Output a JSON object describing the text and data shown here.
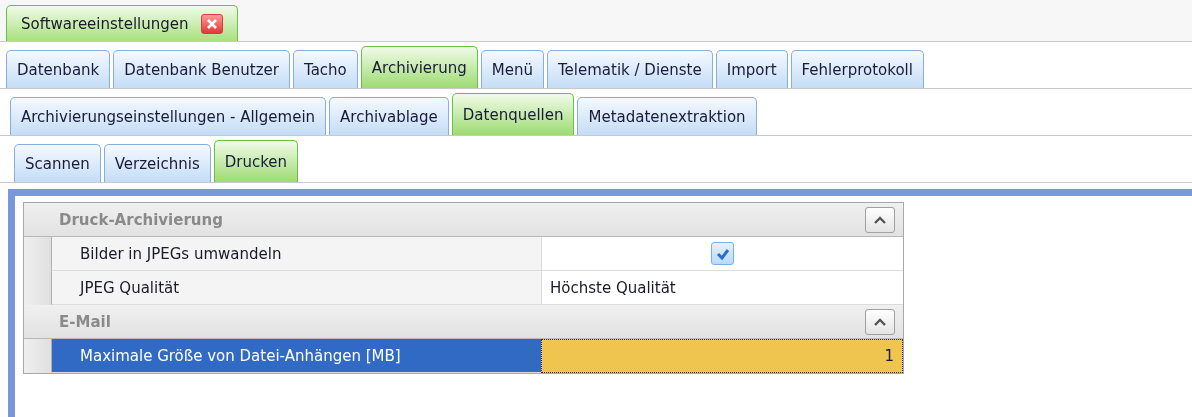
{
  "document_tab": {
    "title": "Softwareeinstellungen"
  },
  "tabs": [
    {
      "label": "Datenbank",
      "selected": false
    },
    {
      "label": "Datenbank Benutzer",
      "selected": false
    },
    {
      "label": "Tacho",
      "selected": false
    },
    {
      "label": "Archivierung",
      "selected": true
    },
    {
      "label": "Menü",
      "selected": false
    },
    {
      "label": "Telematik / Dienste",
      "selected": false
    },
    {
      "label": "Import",
      "selected": false
    },
    {
      "label": "Fehlerprotokoll",
      "selected": false
    }
  ],
  "subtabs": [
    {
      "label": "Archivierungseinstellungen - Allgemein",
      "selected": false
    },
    {
      "label": "Archivablage",
      "selected": false
    },
    {
      "label": "Datenquellen",
      "selected": true
    },
    {
      "label": "Metadatenextraktion",
      "selected": false
    }
  ],
  "source_tabs": [
    {
      "label": "Scannen",
      "selected": false
    },
    {
      "label": "Verzeichnis",
      "selected": false
    },
    {
      "label": "Drucken",
      "selected": true
    }
  ],
  "property_grid": {
    "categories": [
      {
        "title": "Druck-Archivierung",
        "expanded": true,
        "rows": [
          {
            "name": "Bilder in JPEGs umwandeln",
            "kind": "checkbox",
            "checked": true,
            "selected": false
          },
          {
            "name": "JPEG Qualität",
            "kind": "text",
            "value": "Höchste Qualität",
            "selected": false
          }
        ]
      },
      {
        "title": "E-Mail",
        "expanded": true,
        "rows": [
          {
            "name": "Maximale Größe von Datei-Anhängen [MB]",
            "kind": "number",
            "value": "1",
            "selected": true
          }
        ]
      }
    ]
  }
}
